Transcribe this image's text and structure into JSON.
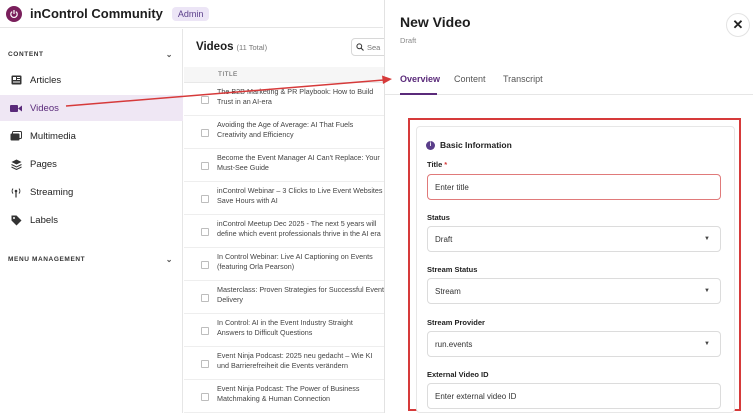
{
  "app": {
    "title": "inControl Community",
    "badge": "Admin"
  },
  "sidebar": {
    "content_header": "CONTENT",
    "menu_header": "MENU MANAGEMENT",
    "items": [
      {
        "label": "Articles",
        "icon": "newspaper-icon"
      },
      {
        "label": "Videos",
        "icon": "video-camera-icon"
      },
      {
        "label": "Multimedia",
        "icon": "gallery-icon"
      },
      {
        "label": "Pages",
        "icon": "layers-icon"
      },
      {
        "label": "Streaming",
        "icon": "broadcast-icon"
      },
      {
        "label": "Labels",
        "icon": "tag-icon"
      }
    ]
  },
  "list": {
    "title": "Videos",
    "count": "(11 Total)",
    "search_placeholder": "Sea",
    "column_header": "TITLE",
    "rows": [
      [
        "The B2B Marketing & PR Playbook: How to Build",
        "Trust in an AI-era"
      ],
      [
        "Avoiding the Age of Average: AI That Fuels",
        "Creativity and Efficiency"
      ],
      [
        "Become the Event Manager AI Can't Replace: Your",
        "Must-See Guide"
      ],
      [
        "inControl Webinar – 3 Clicks to Live Event Websites",
        "Save Hours with AI"
      ],
      [
        "inControl Meetup Dec 2025 - The next 5 years will",
        "define which event professionals thrive in the AI era"
      ],
      [
        "In Control Webinar: Live AI Captioning on Events",
        "(featuring Orla Pearson)"
      ],
      [
        "Masterclass: Proven Strategies for Successful Event",
        "Delivery"
      ],
      [
        "In Control: AI in the Event Industry Straight",
        "Answers to Difficult Questions"
      ],
      [
        "Event Ninja Podcast: 2025 neu gedacht – Wie KI",
        "und Barrierefreiheit die Events verändern"
      ],
      [
        "Event Ninja Podcast: The Power of Business",
        "Matchmaking & Human Connection"
      ]
    ]
  },
  "panel": {
    "title": "New Video",
    "status_sub": "Draft",
    "close_glyph": "✕",
    "tabs": [
      "Overview",
      "Content",
      "Transcript"
    ],
    "section_title": "Basic Information",
    "fields": {
      "title_label": "Title",
      "title_required": "*",
      "title_placeholder": "Enter title",
      "status_label": "Status",
      "status_value": "Draft",
      "stream_status_label": "Stream Status",
      "stream_status_value": "Stream",
      "stream_provider_label": "Stream Provider",
      "stream_provider_value": "run.events",
      "external_id_label": "External Video ID",
      "external_id_placeholder": "Enter external video ID"
    }
  },
  "colors": {
    "accent": "#5a2a7a",
    "highlight": "#d63a3a",
    "logo": "#7a1f5c"
  }
}
